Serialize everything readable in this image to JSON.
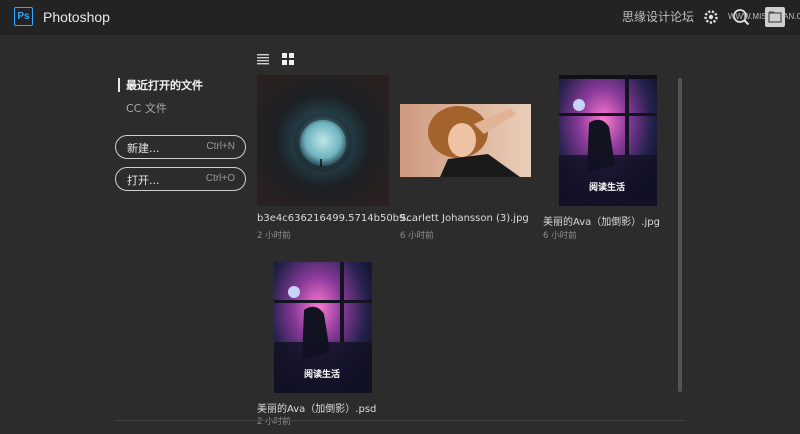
{
  "app": {
    "title": "Photoshop",
    "logo_text": "Ps"
  },
  "watermark": {
    "text": "思缘设计论坛",
    "url": "WWW.MISSYUAN.COM"
  },
  "nav": {
    "recent": "最近打开的文件",
    "cc_files": "CC 文件"
  },
  "actions": {
    "new_label": "新建...",
    "new_shortcut": "Ctrl+N",
    "open_label": "打开...",
    "open_shortcut": "Ctrl+O"
  },
  "files": [
    {
      "name": "b3e4c636216499.5714b50b9...",
      "time": "2 小时前"
    },
    {
      "name": "Scarlett Johansson (3).jpg",
      "time": "6 小时前"
    },
    {
      "name": "美丽的Ava（加倒影）.jpg",
      "time": "6 小时前",
      "seal": "阅读生活"
    },
    {
      "name": "美丽的Ava（加倒影）.psd",
      "time": "2 小时前",
      "seal": "阅读生活"
    }
  ],
  "colors": {
    "accent": "#31a8ff",
    "background": "#2c2c2c",
    "titlebar": "#232323"
  },
  "icons": [
    "gear-icon",
    "search-icon",
    "folder-icon",
    "list-view-icon",
    "grid-view-icon"
  ]
}
